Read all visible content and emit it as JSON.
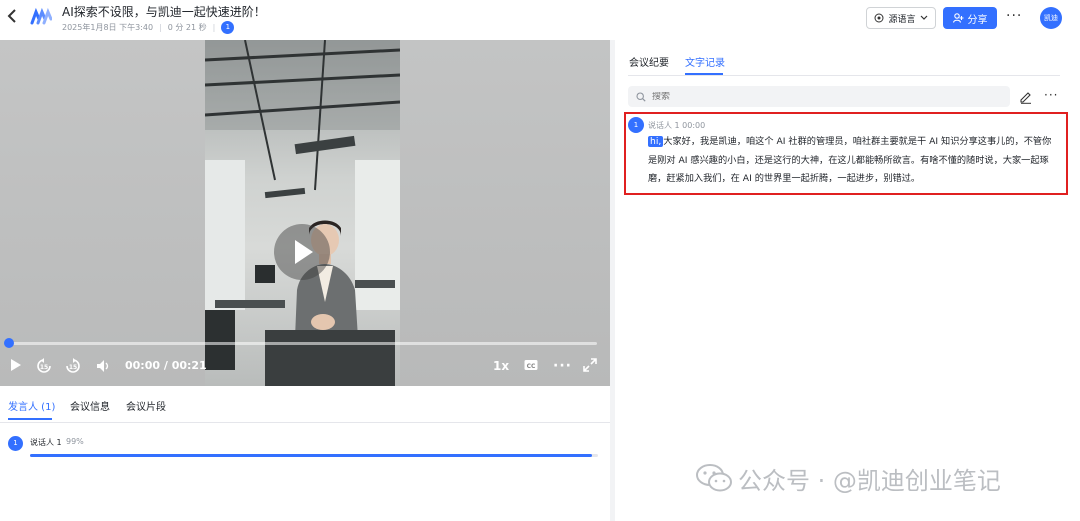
{
  "header": {
    "back_icon": "chevron-left-icon",
    "logo_icon": "app-logo-icon",
    "title": "AI探索不设限，与凯迪一起快速进阶！",
    "date": "2025年1月8日 下午3:40",
    "duration": "0 分 21 秒",
    "participants_count": "1",
    "language_button": "源语言",
    "share_button": "分享",
    "more_icon": "more-horizontal-icon",
    "avatar_label": "凯迪"
  },
  "video": {
    "time": "00:00 / 00:21",
    "speed": "1x",
    "cc": "CC",
    "progress_fraction": 0.0
  },
  "left_tabs": {
    "items": [
      "发言人 (1)",
      "会议信息",
      "会议片段"
    ],
    "active": 0
  },
  "speakers": [
    {
      "avatar": "1",
      "name": "说话人 1",
      "percent": "99%",
      "fraction": 0.99
    }
  ],
  "right_tabs": {
    "items": [
      "会议纪要",
      "文字记录"
    ],
    "active": 1
  },
  "search": {
    "placeholder": "搜索"
  },
  "transcript": {
    "avatar": "1",
    "speaker_time": "说话人 1  00:00",
    "highlight_word": "hi,",
    "text": "大家好，我是凯迪，咱这个 AI 社群的管理员，咱社群主要就是干 AI 知识分享这事儿的，不管你是刚对 AI 感兴趣的小白，还是这行的大神，在这儿都能畅所欲言。有啥不懂的随时说，大家一起琢磨，赶紧加入我们，在 AI 的世界里一起折腾，一起进步，别错过。"
  },
  "watermark": {
    "text": "公众号 · @凯迪创业笔记"
  },
  "colors": {
    "accent": "#3370ff",
    "highlight_border": "#e02020"
  }
}
